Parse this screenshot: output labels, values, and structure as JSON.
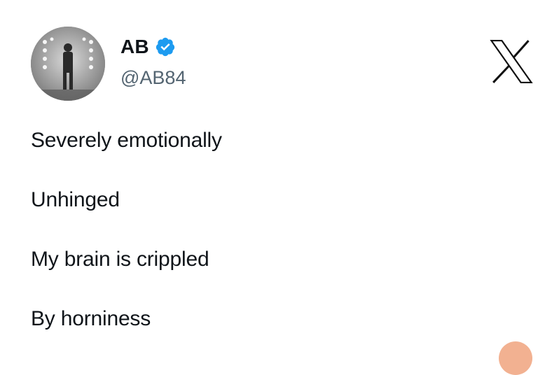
{
  "post": {
    "author": {
      "display_name": "AB",
      "handle": "@AB84",
      "verified": true,
      "avatar_icon": "profile-photo",
      "verified_icon": "verified-badge-icon",
      "verified_color": "#1d9bf0"
    },
    "platform_icon": "x-logo-icon",
    "lines": [
      "Severely emotionally",
      "Unhinged",
      "My brain is crippled",
      "By horniness"
    ]
  }
}
